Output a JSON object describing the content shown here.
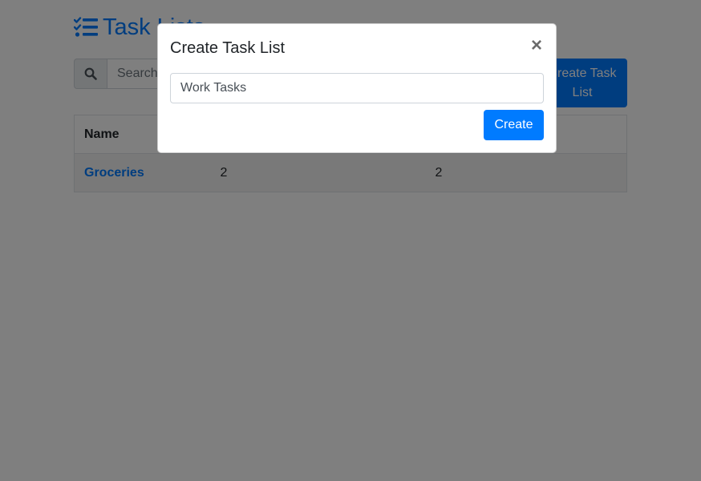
{
  "page": {
    "title": "Task Lists",
    "title_icon": "tasks-list-icon"
  },
  "toolbar": {
    "search_icon": "search-icon",
    "search_placeholder": "Search",
    "create_button_label": "Create Task List"
  },
  "table": {
    "columns": [
      "Name",
      "",
      ""
    ],
    "rows": [
      {
        "name": "Groceries",
        "col2": "2",
        "col3": "2"
      }
    ]
  },
  "modal": {
    "title": "Create Task List",
    "close_icon": "close-icon",
    "close_label": "×",
    "input_value": "Work Tasks",
    "submit_label": "Create"
  },
  "colors": {
    "primary": "#007bff",
    "backdrop": "rgba(0,0,0,0.5)"
  }
}
